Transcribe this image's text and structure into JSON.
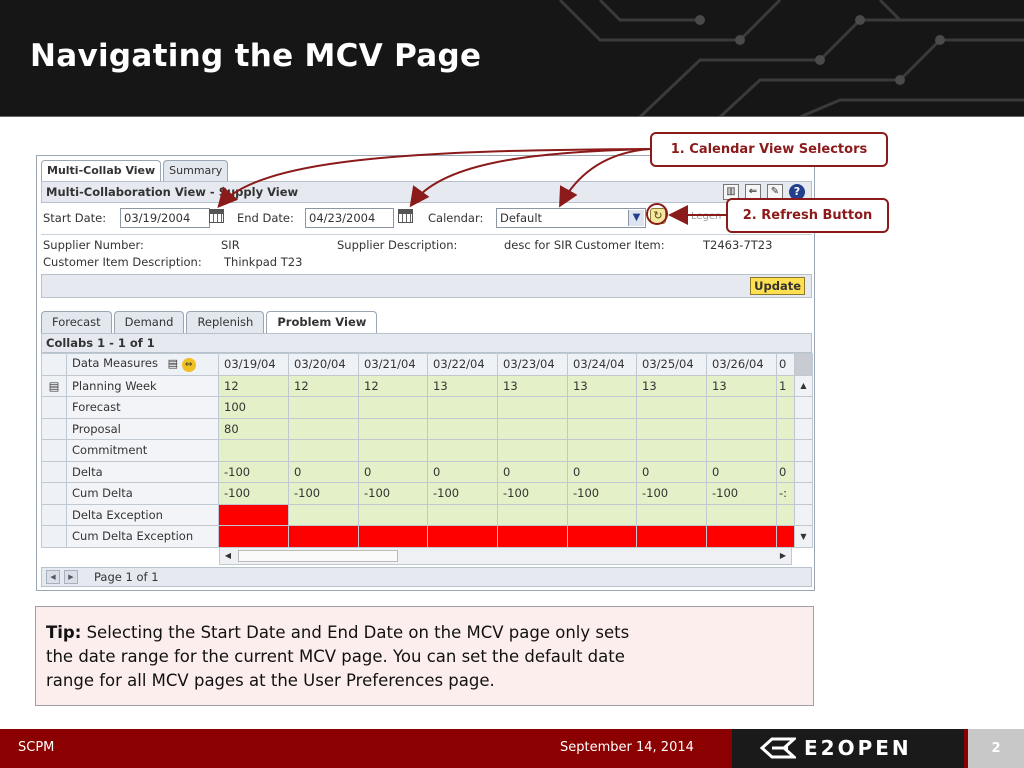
{
  "slide": {
    "title": "Navigating the MCV Page",
    "callouts": {
      "calendar": "1. Calendar View Selectors",
      "refresh": "2. Refresh Button"
    },
    "tip": {
      "label": "Tip:",
      "line1": "Selecting the Start Date and End Date on the MCV page only sets",
      "line2": "the date range for the current MCV page.  You can set the default date",
      "line3": "range for all MCV pages at the User Preferences page."
    },
    "footer": {
      "left": "SCPM",
      "date": "September 14, 2014",
      "logo": "E2OPEN",
      "page": "2"
    },
    "colors": {
      "accent": "#8b0000",
      "callout": "#8b1a1a",
      "cell_green": "#e4f0c8",
      "cell_red": "#ff0000"
    }
  },
  "app": {
    "tabs": [
      "Multi-Collab View",
      "Summary"
    ],
    "section_title": "Multi-Collaboration View - Supply View",
    "start_date_label": "Start Date:",
    "start_date_value": "03/19/2004",
    "end_date_label": "End Date:",
    "end_date_value": "04/23/2004",
    "calendar_label": "Calendar:",
    "calendar_value": "Default",
    "legend_label": "Legen",
    "supplier_number_label": "Supplier Number:",
    "supplier_number_value": "SIR",
    "supplier_desc_label": "Supplier Description:",
    "supplier_desc_value": "desc for SIR",
    "customer_item_label": "Customer Item:",
    "customer_item_value": "T2463-7T23",
    "customer_item_desc_label": "Customer Item Description:",
    "customer_item_desc_value": "Thinkpad T23",
    "update_label": "Update",
    "view_tabs": [
      "Forecast",
      "Demand",
      "Replenish",
      "Problem View"
    ],
    "collabs_label": "Collabs 1 - 1 of 1",
    "grid_header": "Data Measures",
    "dates": [
      "03/19/04",
      "03/20/04",
      "03/21/04",
      "03/22/04",
      "03/23/04",
      "03/24/04",
      "03/25/04",
      "03/26/04",
      "0"
    ],
    "rows": [
      {
        "label": "Planning Week",
        "cells": [
          "12",
          "12",
          "12",
          "13",
          "13",
          "13",
          "13",
          "13",
          "1"
        ]
      },
      {
        "label": "Forecast",
        "cells": [
          "100",
          "",
          "",
          "",
          "",
          "",
          "",
          "",
          ""
        ]
      },
      {
        "label": "Proposal",
        "cells": [
          "80",
          "",
          "",
          "",
          "",
          "",
          "",
          "",
          ""
        ]
      },
      {
        "label": "Commitment",
        "cells": [
          "",
          "",
          "",
          "",
          "",
          "",
          "",
          "",
          ""
        ]
      },
      {
        "label": "Delta",
        "cells": [
          "-100",
          "0",
          "0",
          "0",
          "0",
          "0",
          "0",
          "0",
          "0"
        ]
      },
      {
        "label": "Cum Delta",
        "cells": [
          "-100",
          "-100",
          "-100",
          "-100",
          "-100",
          "-100",
          "-100",
          "-100",
          "-:"
        ]
      },
      {
        "label": "Delta Exception",
        "cells": [
          "",
          "",
          "",
          "",
          "",
          "",
          "",
          "",
          ""
        ]
      },
      {
        "label": "Cum Delta Exception",
        "cells": [
          "",
          "",
          "",
          "",
          "",
          "",
          "",
          "",
          ""
        ]
      }
    ],
    "pager_label": "Page 1 of 1"
  }
}
